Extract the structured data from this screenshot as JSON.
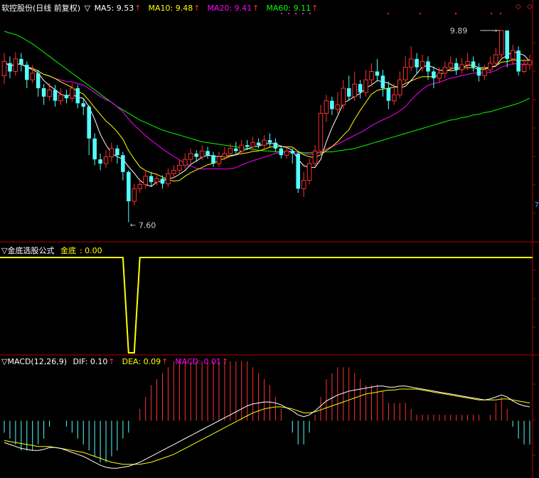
{
  "main_panel": {
    "stock_label": "软控股份(日线 前复权)",
    "toggle_glyph": "▽",
    "indicators": [
      {
        "name": "MA5",
        "value": "9.53",
        "color": "#ffffff"
      },
      {
        "name": "MA10",
        "value": "9.48",
        "color": "#ffff00"
      },
      {
        "name": "MA20",
        "value": "9.41",
        "color": "#ff00ff"
      },
      {
        "name": "MA60",
        "value": "9.11",
        "color": "#00ff00"
      }
    ],
    "high_label": "9.89",
    "low_label": "7.60",
    "axis_tag": "7",
    "controls": [
      "◇",
      "◇"
    ]
  },
  "formula_panel": {
    "title": "▽金底选股公式",
    "indicator_name": "金底",
    "indicator_value": "0.00"
  },
  "macd_panel": {
    "title": "▽MACD(12,26,9)",
    "indicators": [
      {
        "name": "DIF",
        "value": "0.10",
        "color": "#ffffff"
      },
      {
        "name": "DEA",
        "value": "0.09",
        "color": "#ffff00"
      },
      {
        "name": "MACD",
        "value": "0.01",
        "color": "#ff00ff"
      }
    ]
  },
  "colors": {
    "up": "#ff3030",
    "down": "#54ffff",
    "ma5": "#ffffff",
    "ma10": "#ffff00",
    "ma20": "#ff00ff",
    "ma60": "#00ff00",
    "border": "#b00000"
  },
  "chart_data": {
    "type": "candlestick",
    "candles": [
      [
        9.35,
        9.52,
        9.62,
        9.25
      ],
      [
        9.5,
        9.4,
        9.58,
        9.32
      ],
      [
        9.4,
        9.55,
        9.63,
        9.35
      ],
      [
        9.55,
        9.48,
        9.62,
        9.4
      ],
      [
        9.48,
        9.3,
        9.52,
        9.2
      ],
      [
        9.3,
        9.38,
        9.48,
        9.26
      ],
      [
        9.38,
        9.2,
        9.42,
        9.1
      ],
      [
        9.2,
        9.1,
        9.25,
        9.0
      ],
      [
        9.1,
        9.18,
        9.26,
        9.05
      ],
      [
        9.18,
        9.05,
        9.24,
        8.98
      ],
      [
        9.05,
        9.12,
        9.2,
        9.0
      ],
      [
        9.12,
        9.08,
        9.18,
        9.02
      ],
      [
        9.08,
        9.2,
        9.26,
        9.04
      ],
      [
        9.2,
        9.02,
        9.24,
        8.96
      ],
      [
        9.02,
        8.98,
        9.08,
        8.88
      ],
      [
        8.98,
        8.6,
        9.0,
        8.4
      ],
      [
        8.6,
        8.35,
        8.66,
        8.28
      ],
      [
        8.35,
        8.3,
        8.42,
        8.22
      ],
      [
        8.3,
        8.38,
        8.46,
        8.25
      ],
      [
        8.38,
        8.48,
        8.55,
        8.32
      ],
      [
        8.48,
        8.4,
        8.52,
        8.3
      ],
      [
        8.4,
        8.2,
        8.44,
        8.1
      ],
      [
        8.2,
        7.85,
        8.22,
        7.6
      ],
      [
        7.85,
        8.0,
        8.06,
        7.8
      ],
      [
        8.0,
        8.05,
        8.12,
        7.95
      ],
      [
        8.05,
        8.15,
        8.22,
        8.0
      ],
      [
        8.15,
        8.08,
        8.2,
        8.02
      ],
      [
        8.08,
        8.12,
        8.18,
        8.04
      ],
      [
        8.12,
        8.06,
        8.16,
        8.0
      ],
      [
        8.06,
        8.18,
        8.24,
        8.02
      ],
      [
        8.18,
        8.22,
        8.28,
        8.12
      ],
      [
        8.22,
        8.28,
        8.34,
        8.18
      ],
      [
        8.28,
        8.35,
        8.42,
        8.24
      ],
      [
        8.35,
        8.42,
        8.48,
        8.3
      ],
      [
        8.42,
        8.38,
        8.46,
        8.32
      ],
      [
        8.38,
        8.45,
        8.52,
        8.34
      ],
      [
        8.45,
        8.4,
        8.5,
        8.36
      ],
      [
        8.4,
        8.3,
        8.44,
        8.26
      ],
      [
        8.3,
        8.38,
        8.44,
        8.26
      ],
      [
        8.38,
        8.42,
        8.5,
        8.34
      ],
      [
        8.42,
        8.48,
        8.54,
        8.38
      ],
      [
        8.48,
        8.45,
        8.56,
        8.4
      ],
      [
        8.45,
        8.52,
        8.58,
        8.4
      ],
      [
        8.52,
        8.5,
        8.58,
        8.46
      ],
      [
        8.5,
        8.55,
        8.62,
        8.46
      ],
      [
        8.55,
        8.52,
        8.6,
        8.48
      ],
      [
        8.52,
        8.58,
        8.64,
        8.48
      ],
      [
        8.58,
        8.55,
        8.66,
        8.5
      ],
      [
        8.55,
        8.48,
        8.6,
        8.44
      ],
      [
        8.48,
        8.4,
        8.52,
        8.36
      ],
      [
        8.4,
        8.45,
        8.5,
        8.36
      ],
      [
        8.45,
        8.42,
        8.48,
        8.3
      ],
      [
        8.42,
        8.0,
        8.44,
        7.95
      ],
      [
        8.0,
        8.1,
        8.2,
        7.9
      ],
      [
        8.1,
        8.3,
        8.36,
        8.05
      ],
      [
        8.3,
        8.45,
        8.52,
        8.26
      ],
      [
        8.45,
        8.9,
        9.0,
        8.4
      ],
      [
        8.9,
        9.05,
        9.12,
        8.8
      ],
      [
        9.05,
        8.95,
        9.1,
        8.88
      ],
      [
        8.95,
        9.0,
        9.15,
        8.9
      ],
      [
        9.0,
        9.2,
        9.3,
        8.95
      ],
      [
        9.2,
        9.1,
        9.35,
        9.05
      ],
      [
        9.1,
        9.25,
        9.4,
        9.05
      ],
      [
        9.25,
        9.15,
        9.3,
        9.08
      ],
      [
        9.15,
        9.3,
        9.42,
        9.1
      ],
      [
        9.3,
        9.4,
        9.5,
        9.22
      ],
      [
        9.4,
        9.35,
        9.55,
        9.28
      ],
      [
        9.35,
        9.2,
        9.42,
        9.1
      ],
      [
        9.2,
        9.05,
        9.28,
        8.95
      ],
      [
        9.05,
        9.12,
        9.25,
        9.0
      ],
      [
        9.12,
        9.3,
        9.4,
        9.08
      ],
      [
        9.3,
        9.45,
        9.58,
        9.25
      ],
      [
        9.45,
        9.55,
        9.7,
        9.4
      ],
      [
        9.55,
        9.45,
        9.62,
        9.38
      ],
      [
        9.45,
        9.52,
        9.6,
        9.4
      ],
      [
        9.52,
        9.4,
        9.58,
        9.3
      ],
      [
        9.4,
        9.32,
        9.46,
        9.2
      ],
      [
        9.32,
        9.38,
        9.45,
        9.26
      ],
      [
        9.38,
        9.45,
        9.52,
        9.32
      ],
      [
        9.45,
        9.5,
        9.58,
        9.4
      ],
      [
        9.5,
        9.42,
        9.56,
        9.36
      ],
      [
        9.42,
        9.48,
        9.56,
        9.38
      ],
      [
        9.48,
        9.52,
        9.62,
        9.42
      ],
      [
        9.52,
        9.45,
        9.58,
        9.4
      ],
      [
        9.45,
        9.35,
        9.5,
        9.28
      ],
      [
        9.35,
        9.42,
        9.48,
        9.3
      ],
      [
        9.42,
        9.5,
        9.58,
        9.38
      ],
      [
        9.5,
        9.6,
        9.68,
        9.45
      ],
      [
        9.6,
        9.89,
        9.89,
        9.55
      ],
      [
        9.89,
        9.55,
        9.8,
        9.45
      ],
      [
        9.55,
        9.65,
        9.72,
        9.48
      ],
      [
        9.65,
        9.4,
        9.7,
        9.35
      ],
      [
        9.4,
        9.48,
        9.55,
        9.38
      ],
      [
        9.48,
        9.53,
        9.6,
        9.42
      ]
    ],
    "ma60": [
      9.88,
      9.86,
      9.84,
      9.81,
      9.77,
      9.73,
      9.68,
      9.63,
      9.58,
      9.53,
      9.48,
      9.43,
      9.38,
      9.33,
      9.28,
      9.23,
      9.18,
      9.13,
      9.08,
      9.03,
      8.98,
      8.94,
      8.9,
      8.86,
      8.82,
      8.79,
      8.76,
      8.73,
      8.7,
      8.68,
      8.66,
      8.64,
      8.62,
      8.6,
      8.58,
      8.56,
      8.55,
      8.54,
      8.53,
      8.52,
      8.51,
      8.5,
      8.49,
      8.48,
      8.47,
      8.46,
      8.45,
      8.45,
      8.44,
      8.44,
      8.44,
      8.44,
      8.44,
      8.43,
      8.43,
      8.43,
      8.43,
      8.44,
      8.44,
      8.45,
      8.46,
      8.47,
      8.48,
      8.5,
      8.52,
      8.54,
      8.56,
      8.58,
      8.6,
      8.62,
      8.64,
      8.66,
      8.68,
      8.7,
      8.72,
      8.74,
      8.76,
      8.78,
      8.8,
      8.82,
      8.83,
      8.85,
      8.86,
      8.88,
      8.89,
      8.91,
      8.92,
      8.94,
      8.96,
      8.98,
      9.0,
      9.02,
      9.05,
      9.08
    ],
    "price_range": [
      7.45,
      10.05
    ],
    "signal": [
      1,
      1,
      1,
      1,
      1,
      1,
      1,
      1,
      1,
      1,
      1,
      1,
      1,
      1,
      1,
      1,
      1,
      1,
      1,
      1,
      1,
      1,
      0,
      0,
      1,
      1,
      1,
      1,
      1,
      1,
      1,
      1,
      1,
      1,
      1,
      1,
      1,
      1,
      1,
      1,
      1,
      1,
      1,
      1,
      1,
      1,
      1,
      1,
      1,
      1,
      1,
      1,
      1,
      1,
      1,
      1,
      1,
      1,
      1,
      1,
      1,
      1,
      1,
      1,
      1,
      1,
      1,
      1,
      1,
      1,
      1,
      1,
      1,
      1,
      1,
      1,
      1,
      1,
      1,
      1,
      1,
      1,
      1,
      1,
      1,
      1,
      1,
      1,
      1,
      1,
      1,
      1,
      1,
      1
    ],
    "macd_dif": [
      -0.22,
      -0.24,
      -0.26,
      -0.28,
      -0.29,
      -0.3,
      -0.3,
      -0.29,
      -0.27,
      -0.27,
      -0.28,
      -0.3,
      -0.32,
      -0.34,
      -0.36,
      -0.39,
      -0.42,
      -0.45,
      -0.47,
      -0.48,
      -0.48,
      -0.47,
      -0.46,
      -0.44,
      -0.42,
      -0.39,
      -0.36,
      -0.33,
      -0.3,
      -0.27,
      -0.24,
      -0.21,
      -0.18,
      -0.15,
      -0.12,
      -0.09,
      -0.06,
      -0.03,
      0.0,
      0.03,
      0.06,
      0.09,
      0.12,
      0.15,
      0.17,
      0.18,
      0.19,
      0.19,
      0.18,
      0.16,
      0.13,
      0.1,
      0.06,
      0.04,
      0.06,
      0.1,
      0.15,
      0.2,
      0.23,
      0.26,
      0.28,
      0.3,
      0.31,
      0.32,
      0.33,
      0.34,
      0.35,
      0.35,
      0.34,
      0.34,
      0.35,
      0.35,
      0.34,
      0.33,
      0.32,
      0.31,
      0.3,
      0.29,
      0.28,
      0.27,
      0.26,
      0.25,
      0.24,
      0.23,
      0.22,
      0.21,
      0.22,
      0.24,
      0.26,
      0.24,
      0.2,
      0.17,
      0.15,
      0.14
    ],
    "macd_dea": [
      -0.2,
      -0.21,
      -0.22,
      -0.23,
      -0.24,
      -0.25,
      -0.26,
      -0.26,
      -0.26,
      -0.27,
      -0.28,
      -0.29,
      -0.3,
      -0.31,
      -0.32,
      -0.34,
      -0.36,
      -0.38,
      -0.4,
      -0.42,
      -0.43,
      -0.44,
      -0.44,
      -0.44,
      -0.44,
      -0.43,
      -0.42,
      -0.4,
      -0.38,
      -0.36,
      -0.34,
      -0.31,
      -0.28,
      -0.25,
      -0.22,
      -0.19,
      -0.16,
      -0.13,
      -0.1,
      -0.07,
      -0.04,
      -0.01,
      0.02,
      0.05,
      0.08,
      0.1,
      0.12,
      0.13,
      0.14,
      0.14,
      0.13,
      0.12,
      0.1,
      0.08,
      0.08,
      0.09,
      0.11,
      0.13,
      0.15,
      0.17,
      0.19,
      0.21,
      0.23,
      0.25,
      0.27,
      0.28,
      0.29,
      0.3,
      0.31,
      0.31,
      0.32,
      0.32,
      0.32,
      0.32,
      0.31,
      0.3,
      0.29,
      0.28,
      0.27,
      0.26,
      0.25,
      0.24,
      0.23,
      0.22,
      0.21,
      0.21,
      0.21,
      0.21,
      0.22,
      0.22,
      0.21,
      0.2,
      0.19,
      0.18
    ],
    "macd_range": [
      -0.55,
      0.55
    ]
  }
}
